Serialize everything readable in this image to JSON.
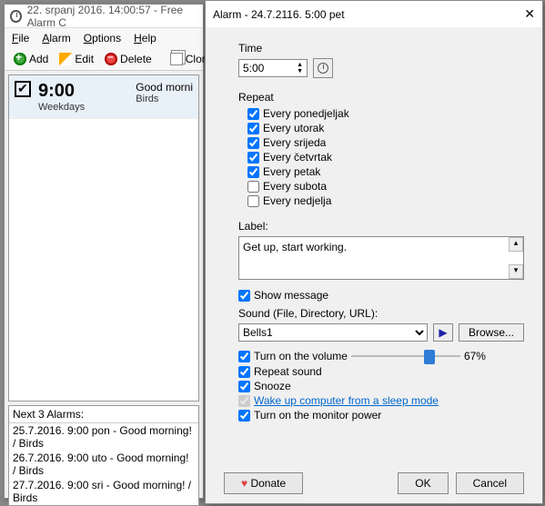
{
  "main": {
    "title": "22. srpanj 2016. 14:00:57 - Free Alarm C",
    "menu": {
      "file": "File",
      "alarm": "Alarm",
      "options": "Options",
      "help": "Help"
    },
    "toolbar": {
      "add": "Add",
      "edit": "Edit",
      "delete": "Delete",
      "clone": "Clone"
    },
    "alarm": {
      "time": "9:00",
      "days": "Weekdays",
      "label": "Good morni",
      "sound": "Birds"
    },
    "next": {
      "header": "Next 3 Alarms:",
      "lines": [
        "25.7.2016. 9:00 pon - Good morning! / Birds",
        "26.7.2016. 9:00 uto - Good morning! / Birds",
        "27.7.2016. 9:00 sri - Good morning! / Birds"
      ]
    }
  },
  "dlg": {
    "title": "Alarm - 24.7.2116. 5:00 pet",
    "time_label": "Time",
    "time_value": "5:00",
    "repeat_label": "Repeat",
    "repeat": [
      {
        "label": "Every ponedjeljak",
        "checked": true
      },
      {
        "label": "Every utorak",
        "checked": true
      },
      {
        "label": "Every srijeda",
        "checked": true
      },
      {
        "label": "Every četvrtak",
        "checked": true
      },
      {
        "label": "Every petak",
        "checked": true
      },
      {
        "label": "Every subota",
        "checked": false
      },
      {
        "label": "Every nedjelja",
        "checked": false
      }
    ],
    "label_label": "Label:",
    "label_text": "Get up, start working.",
    "show_msg": "Show message",
    "sound_label": "Sound (File, Directory, URL):",
    "sound_value": "Bells1",
    "browse": "Browse...",
    "vol_label": "Turn on the volume",
    "vol_pct": "67%",
    "repeat_sound": "Repeat sound",
    "snooze": "Snooze",
    "wake": "Wake up computer from a sleep mode",
    "monitor": "Turn on the monitor power",
    "donate": "Donate",
    "ok": "OK",
    "cancel": "Cancel"
  }
}
